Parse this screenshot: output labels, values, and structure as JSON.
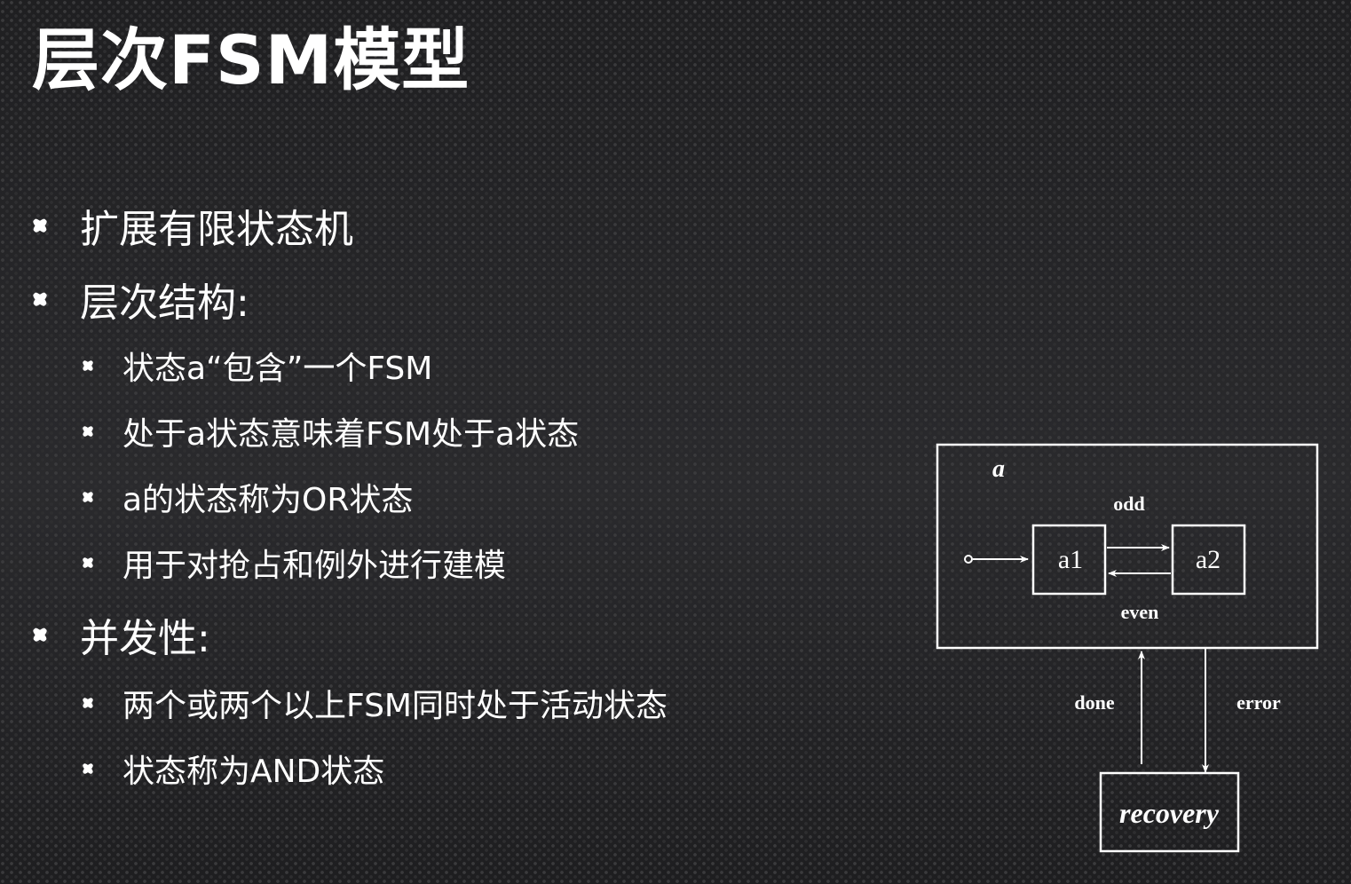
{
  "title": "层次FSM模型",
  "bullets": [
    {
      "level": 1,
      "text": "扩展有限状态机"
    },
    {
      "level": 1,
      "text": "层次结构:"
    },
    {
      "level": 2,
      "text": "状态a“包含”一个FSM"
    },
    {
      "level": 2,
      "text": "处于a状态意味着FSM处于a状态"
    },
    {
      "level": 2,
      "text": "a的状态称为OR状态"
    },
    {
      "level": 2,
      "text": "用于对抢占和例外进行建模"
    },
    {
      "level": 1,
      "text": "并发性:"
    },
    {
      "level": 2,
      "text": "两个或两个以上FSM同时处于活动状态"
    },
    {
      "level": 2,
      "text": "状态称为AND状态"
    }
  ],
  "diagram": {
    "outer_state": "a",
    "state_a1": "a1",
    "state_a2": "a2",
    "edge_odd": "odd",
    "edge_even": "even",
    "edge_done": "done",
    "edge_error": "error",
    "state_recovery": "recovery"
  },
  "colors": {
    "background": "#1c1c1e",
    "foreground": "#ffffff"
  }
}
